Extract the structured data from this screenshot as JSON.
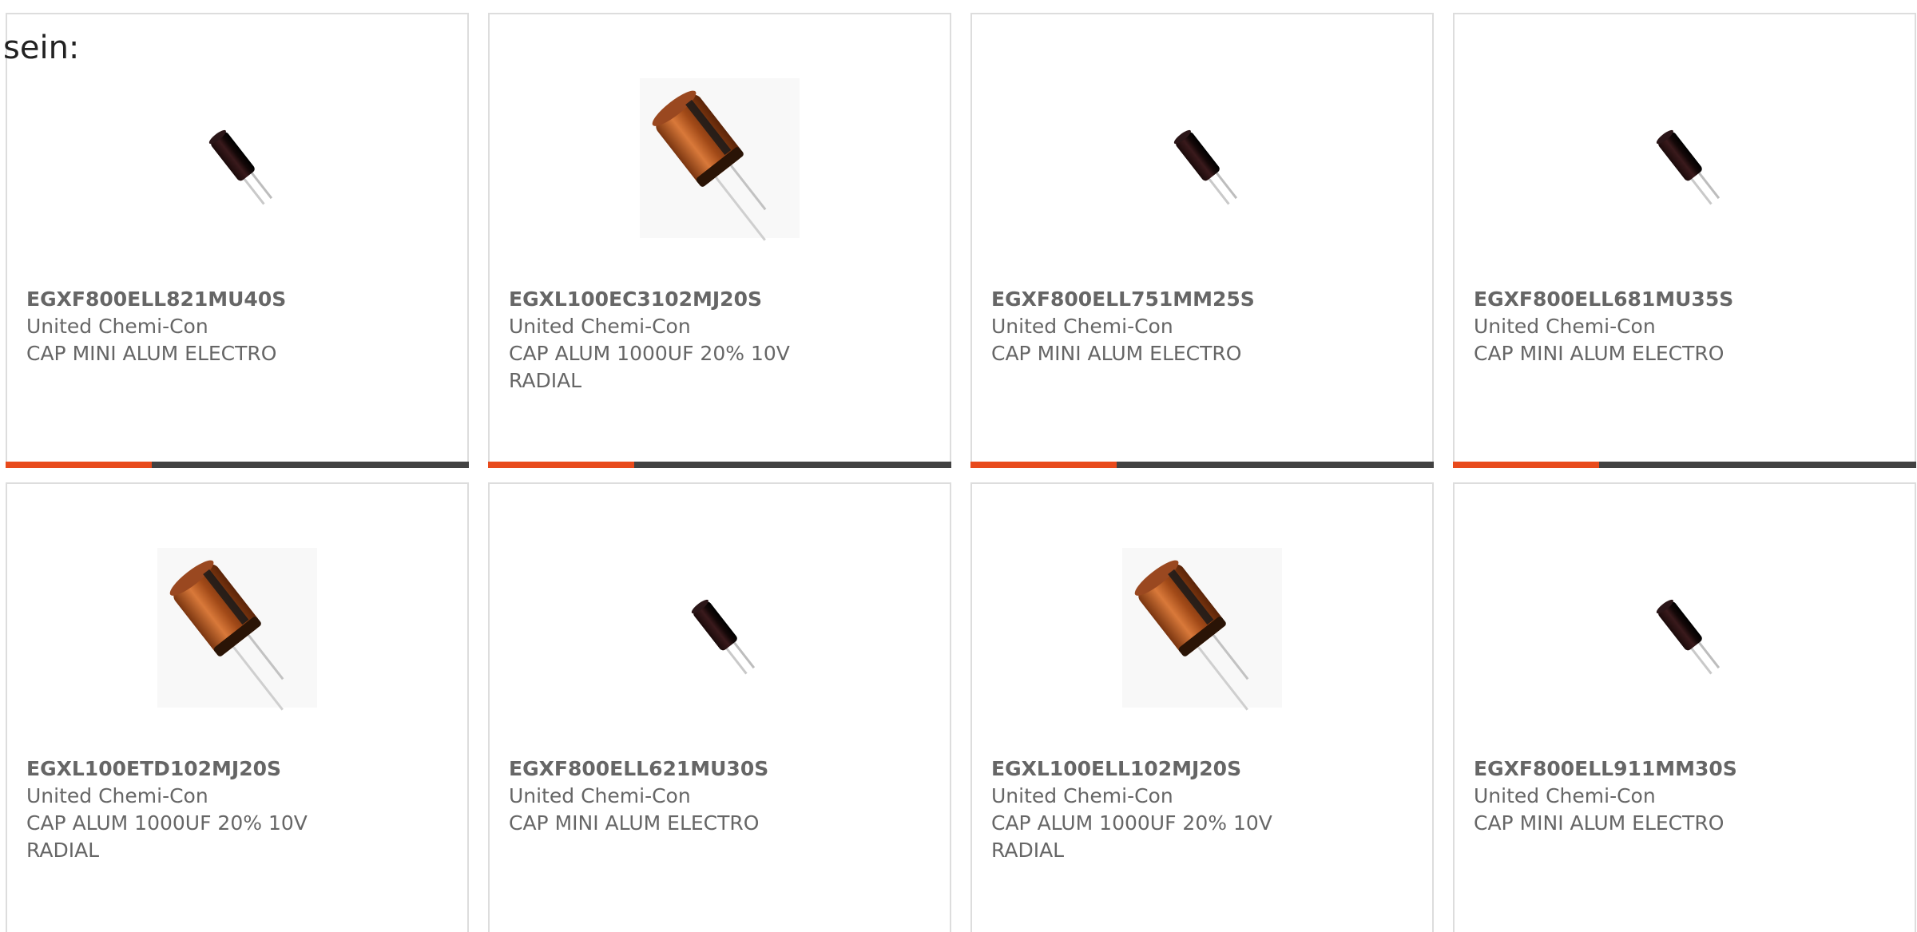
{
  "intro": {
    "text": "sein:"
  },
  "colors": {
    "accent": "#e84a1c",
    "bar_track": "#424242",
    "text": "#666666",
    "border": "#dddddd"
  },
  "products": [
    {
      "part_number": "EGXF800ELL821MU40S",
      "manufacturer": "United Chemi-Con",
      "description": "CAP MINI ALUM ELECTRO",
      "image": "small-black-capacitor-icon",
      "progress": 0.315
    },
    {
      "part_number": "EGXL100EC3102MJ20S",
      "manufacturer": "United Chemi-Con",
      "description": "CAP ALUM 1000UF 20% 10V RADIAL",
      "image": "orange-capacitor-icon",
      "progress": 0.315
    },
    {
      "part_number": "EGXF800ELL751MM25S",
      "manufacturer": "United Chemi-Con",
      "description": "CAP MINI ALUM ELECTRO",
      "image": "small-black-capacitor-icon",
      "progress": 0.315
    },
    {
      "part_number": "EGXF800ELL681MU35S",
      "manufacturer": "United Chemi-Con",
      "description": "CAP MINI ALUM ELECTRO",
      "image": "small-black-capacitor-icon",
      "progress": 0.315
    },
    {
      "part_number": "EGXL100ETD102MJ20S",
      "manufacturer": "United Chemi-Con",
      "description": "CAP ALUM 1000UF 20% 10V RADIAL",
      "image": "orange-capacitor-icon"
    },
    {
      "part_number": "EGXF800ELL621MU30S",
      "manufacturer": "United Chemi-Con",
      "description": "CAP MINI ALUM ELECTRO",
      "image": "small-black-capacitor-icon"
    },
    {
      "part_number": "EGXL100ELL102MJ20S",
      "manufacturer": "United Chemi-Con",
      "description": "CAP ALUM 1000UF 20% 10V RADIAL",
      "image": "orange-capacitor-icon"
    },
    {
      "part_number": "EGXF800ELL911MM30S",
      "manufacturer": "United Chemi-Con",
      "description": "CAP MINI ALUM ELECTRO",
      "image": "small-black-capacitor-icon"
    }
  ]
}
